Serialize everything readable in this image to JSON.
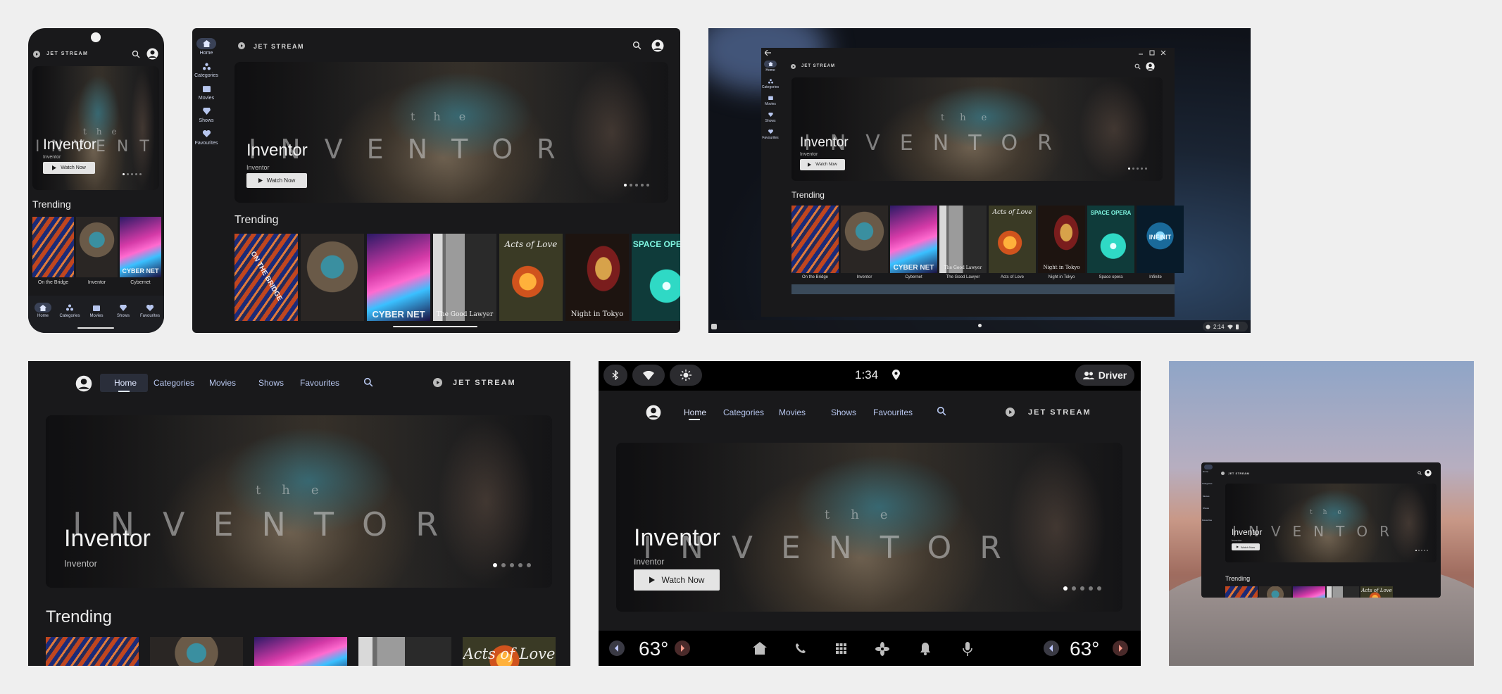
{
  "app": {
    "brand": "JET STREAM",
    "nav": [
      "Home",
      "Categories",
      "Movies",
      "Shows",
      "Favourites"
    ],
    "hero": {
      "title": "Inventor",
      "subtitle": "Inventor",
      "poster_word": "INVENTOR",
      "poster_article": "the",
      "button_label": "Watch Now",
      "carousel_dots": 5,
      "carousel_selected_index": 0
    },
    "trending_label": "Trending",
    "movies": [
      "On the Bridge",
      "Inventor",
      "Cybernet",
      "The Good Lawyer",
      "Acts of Love",
      "Night in Tokyo",
      "Space opera",
      "Infinite"
    ],
    "poster_texts": {
      "cybernet": "CYBER NET",
      "good_lawyer": "The Good Lawyer",
      "acts": "Acts of Love",
      "tokyo": "Night in Tokyo",
      "space": "SPACE OPERA",
      "infinite": "INFINIT",
      "bridge": "ON THE BRIDGE"
    }
  },
  "desktop": {
    "status_time": "2:14"
  },
  "car": {
    "clock": "1:34",
    "driver_label": "Driver",
    "temp_left": "63°",
    "temp_right": "63°"
  },
  "colors": {
    "background": "#efefef",
    "surface": "#19191b",
    "accent": "#b7c6ee",
    "nav_selected": "#3a4257"
  }
}
